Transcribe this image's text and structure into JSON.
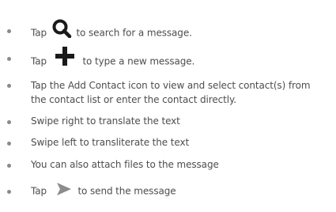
{
  "items": [
    {
      "before": "Tap",
      "icon": "search-icon",
      "after": "to search for a message."
    },
    {
      "before": "Tap",
      "icon": "plus-icon",
      "after": "to type a new message."
    },
    {
      "text": "Tap the Add Contact icon to view and select contact(s) from the contact list or enter the contact directly."
    },
    {
      "text": "Swipe right to translate the text"
    },
    {
      "text": "Swipe left to transliterate the text"
    },
    {
      "text": "You can also attach files to the message"
    },
    {
      "before": "Tap",
      "icon": "send-arrow-icon",
      "after": "to send the message"
    }
  ],
  "colors": {
    "text": "#4d4d4d",
    "bullet": "#8a8a8a",
    "icon_dark": "#1a1a1a",
    "icon_send": "#8c8c8c"
  }
}
